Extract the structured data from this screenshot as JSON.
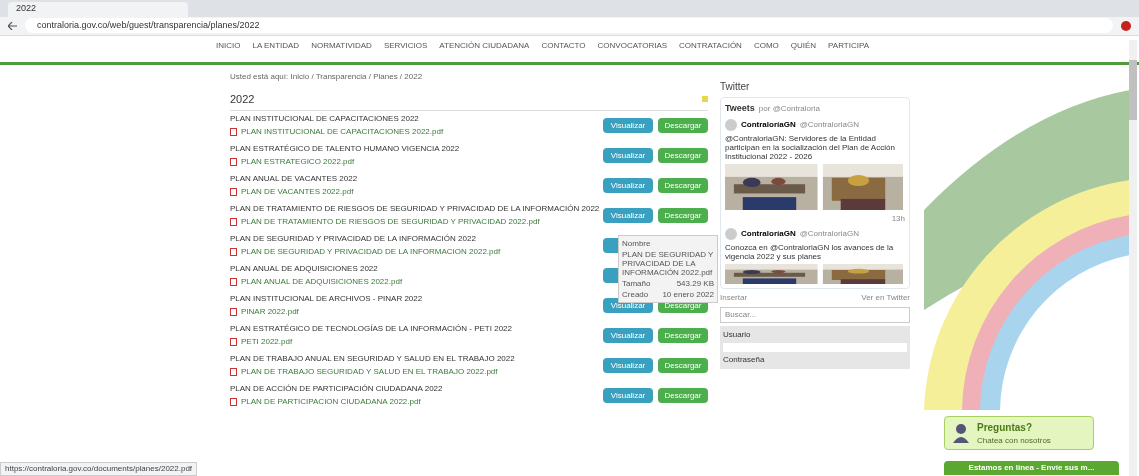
{
  "browser": {
    "tab_title": "2022",
    "url": "contraloria.gov.co/web/guest/transparencia/planes/2022",
    "status_url": "https://contraloria.gov.co/documents/planes/2022.pdf"
  },
  "nav": {
    "items": [
      "INICIO",
      "LA ENTIDAD",
      "NORMATIVIDAD",
      "SERVICIOS",
      "ATENCIÓN CIUDADANA",
      "CONTACTO",
      "CONVOCATORIAS",
      "CONTRATACIÓN",
      "COMO",
      "QUIÉN",
      "PARTICIPA"
    ]
  },
  "breadcrumb": "Usted está aquí: Inicio / Transparencia / Planes / 2022",
  "folder": {
    "title": "2022",
    "rows": [
      {
        "title": "PLAN INSTITUCIONAL DE CAPACITACIONES 2022",
        "file": "PLAN INSTITUCIONAL DE CAPACITACIONES 2022.pdf",
        "covered": false,
        "view_label": "Visualizar",
        "download_label": "Descargar"
      },
      {
        "title": "PLAN ESTRATÉGICO DE TALENTO HUMANO VIGENCIA 2022",
        "file": "PLAN ESTRATEGICO 2022.pdf",
        "covered": false,
        "view_label": "Visualizar",
        "download_label": "Descargar"
      },
      {
        "title": "PLAN ANUAL DE VACANTES 2022",
        "file": "PLAN DE VACANTES 2022.pdf",
        "covered": false,
        "view_label": "Visualizar",
        "download_label": "Descargar"
      },
      {
        "title": "PLAN DE TRATAMIENTO DE RIESGOS DE SEGURIDAD Y PRIVACIDAD DE LA INFORMACIÓN 2022",
        "file": "PLAN DE TRATAMIENTO DE RIESGOS DE SEGURIDAD Y PRIVACIDAD 2022.pdf",
        "covered": false,
        "view_label": "Visualizar",
        "download_label": "Descargar"
      },
      {
        "title": "PLAN DE SEGURIDAD Y PRIVACIDAD DE LA INFORMACIÓN 2022",
        "file": "PLAN DE SEGURIDAD Y PRIVACIDAD DE LA INFORMACION 2022.pdf",
        "covered": true
      },
      {
        "title": "PLAN ANUAL DE ADQUISICIONES 2022",
        "file": "PLAN ANUAL DE ADQUISICIONES 2022.pdf",
        "covered": true
      },
      {
        "title": "PLAN INSTITUCIONAL DE ARCHIVOS - PINAR 2022",
        "file": "PINAR 2022.pdf",
        "covered": false,
        "view_label": "Visualizar",
        "download_label": "Descargar"
      },
      {
        "title": "PLAN ESTRATÉGICO DE TECNOLOGÍAS DE LA INFORMACIÓN - PETI 2022",
        "file": "PETI 2022.pdf",
        "covered": false,
        "view_label": "Visualizar",
        "download_label": "Descargar"
      },
      {
        "title": "PLAN DE TRABAJO ANUAL EN SEGURIDAD Y SALUD EN EL TRABAJO 2022",
        "file": "PLAN DE TRABAJO SEGURIDAD Y SALUD EN EL TRABAJO 2022.pdf",
        "covered": false,
        "view_label": "Visualizar",
        "download_label": "Descargar"
      },
      {
        "title": "PLAN DE ACCIÓN DE PARTICIPACIÓN CIUDADANA 2022",
        "file": "PLAN DE PARTICIPACION CIUDADANA 2022.pdf",
        "covered": false,
        "view_label": "Visualizar",
        "download_label": "Descargar"
      }
    ]
  },
  "tooltip": {
    "heading": "Nombre",
    "name": "PLAN DE SEGURIDAD Y PRIVACIDAD DE LA INFORMACIÓN 2022.pdf",
    "size_label": "Tamaño",
    "size": "543.29 KB",
    "date_label": "Creado",
    "date": "10 enero 2022"
  },
  "twitter": {
    "title": "Twitter",
    "header": "Tweets",
    "by": "por @Contraloria",
    "tweets": [
      {
        "name": "ContraloríaGN",
        "handle": "@ContraloriaGN",
        "text": "@ContraloriaGN: Servidores de la Entidad participan en la socialización del Plan de Acción Institucional 2022 - 2026",
        "time": "13h"
      },
      {
        "name": "ContraloríaGN",
        "handle": "@ContraloriaGN",
        "text": "Conozca en @ContraloriaGN los avances de la vigencia 2022 y sus planes"
      }
    ],
    "embed": "Insertar",
    "view_on": "Ver en Twitter"
  },
  "search": {
    "placeholder": "Buscar..."
  },
  "login": {
    "user_label": "Usuario",
    "password_label": "Contraseña"
  },
  "chat": {
    "title": "Preguntas?",
    "subtitle": "Chatea con nosotros",
    "bar": "Estamos en línea - Envíe sus m..."
  }
}
